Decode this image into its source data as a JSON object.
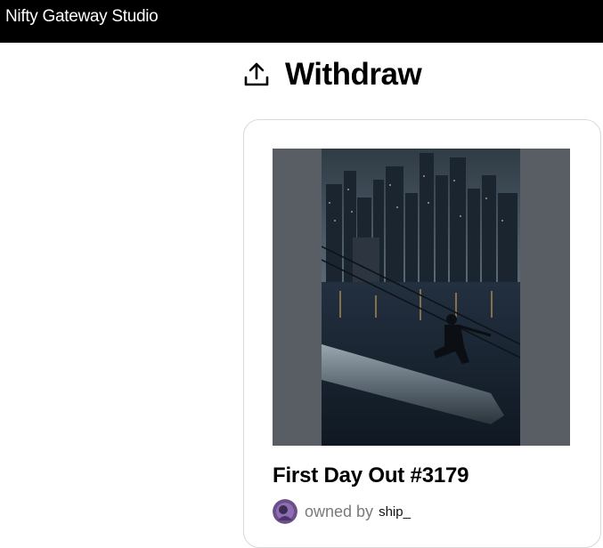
{
  "header": {
    "app_title": "Nifty Gateway Studio"
  },
  "page": {
    "title": "Withdraw",
    "icon": "upload-icon"
  },
  "nft_card": {
    "title": "First Day Out #3179",
    "owned_by_label": "owned by",
    "owner": "ship_",
    "artwork_icon": "city-skyline-artwork",
    "avatar_icon": "owner-avatar"
  },
  "colors": {
    "topbar_bg": "#000000",
    "frame_bg": "#595e64",
    "card_border": "#d9d9d9",
    "muted_text": "#7a7a7a"
  }
}
